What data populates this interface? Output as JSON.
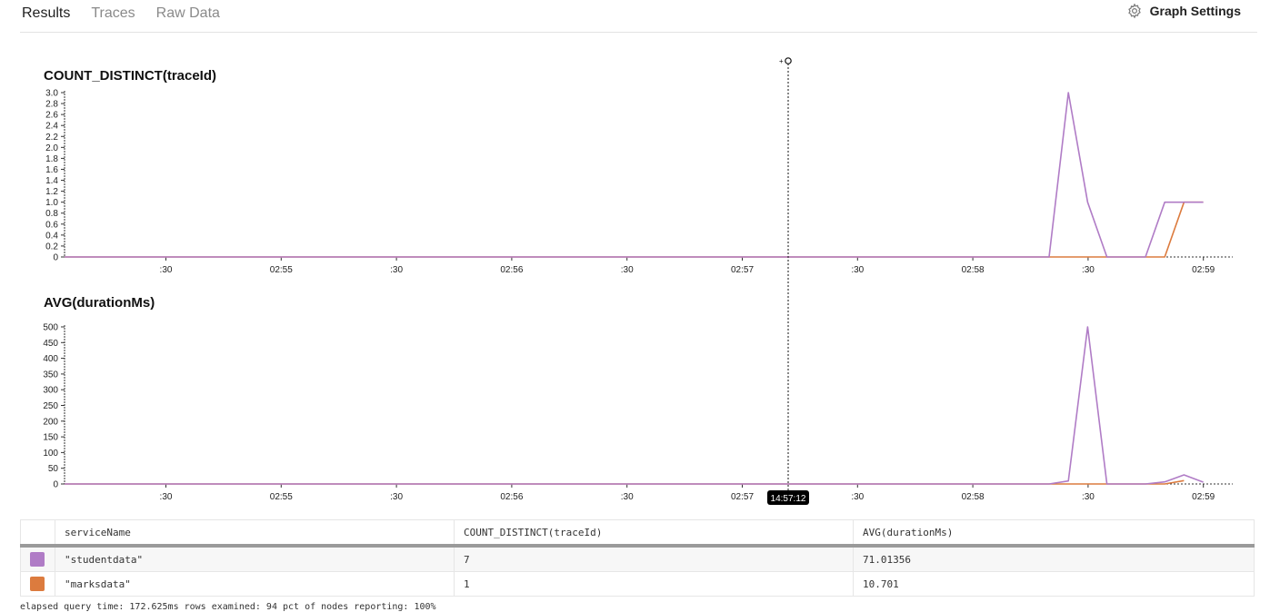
{
  "tabs": [
    {
      "label": "Results",
      "active": true
    },
    {
      "label": "Traces",
      "active": false
    },
    {
      "label": "Raw Data",
      "active": false
    }
  ],
  "graph_settings": {
    "label": "Graph Settings",
    "icon": "gear-icon"
  },
  "crosshair": {
    "time_label": "14:57:12",
    "icon": "add-marker-icon"
  },
  "colors": {
    "studentdata": "#b07cc6",
    "marksdata": "#dc7b3e"
  },
  "chart_data": [
    {
      "type": "line",
      "title": "COUNT_DISTINCT(traceId)",
      "ylim": [
        0,
        3.0
      ],
      "yticks": [
        "0",
        "0.2",
        "0.4",
        "0.6",
        "0.8",
        "1.0",
        "1.2",
        "1.4",
        "1.6",
        "1.8",
        "2.0",
        "2.2",
        "2.4",
        "2.6",
        "2.8",
        "3.0"
      ],
      "x_tick_labels": [
        ":30",
        "02:55",
        ":30",
        "02:56",
        ":30",
        "02:57",
        ":30",
        "02:58",
        ":30",
        "02:59"
      ],
      "series": [
        {
          "name": "studentdata",
          "color": "#b07cc6",
          "points": [
            [
              -90,
              0
            ],
            [
              0,
              0
            ],
            [
              1,
              3
            ],
            [
              2,
              1
            ],
            [
              3,
              0
            ],
            [
              5,
              0
            ],
            [
              6,
              1
            ],
            [
              8,
              1
            ]
          ]
        },
        {
          "name": "marksdata",
          "color": "#dc7b3e",
          "points": [
            [
              -90,
              0
            ],
            [
              6,
              0
            ],
            [
              7,
              1
            ],
            [
              8,
              1
            ]
          ]
        }
      ]
    },
    {
      "type": "line",
      "title": "AVG(durationMs)",
      "ylim": [
        0,
        520
      ],
      "yticks": [
        "0",
        "50",
        "100",
        "150",
        "200",
        "250",
        "300",
        "350",
        "400",
        "450",
        "500"
      ],
      "x_tick_labels": [
        ":30",
        "02:55",
        ":30",
        "02:56",
        ":30",
        "02:57",
        ":30",
        "02:58",
        ":30",
        "02:59"
      ],
      "series": [
        {
          "name": "studentdata",
          "color": "#b07cc6",
          "points": [
            [
              -90,
              0
            ],
            [
              0,
              0
            ],
            [
              1,
              10
            ],
            [
              2,
              520
            ],
            [
              3,
              0
            ],
            [
              5,
              0
            ],
            [
              6,
              7
            ],
            [
              7,
              30
            ],
            [
              8,
              6
            ]
          ]
        },
        {
          "name": "marksdata",
          "color": "#dc7b3e",
          "points": [
            [
              -90,
              0
            ],
            [
              6,
              0
            ],
            [
              7,
              11
            ]
          ]
        }
      ]
    }
  ],
  "table": {
    "columns": [
      "serviceName",
      "COUNT_DISTINCT(traceId)",
      "AVG(durationMs)"
    ],
    "rows": [
      {
        "color": "#b07cc6",
        "serviceName": "\"studentdata\"",
        "count": "7",
        "avg": "71.01356"
      },
      {
        "color": "#dc7b3e",
        "serviceName": "\"marksdata\"",
        "count": "1",
        "avg": "10.701"
      }
    ]
  },
  "footer": "elapsed query time: 172.625ms   rows examined: 94   pct of nodes reporting: 100%"
}
